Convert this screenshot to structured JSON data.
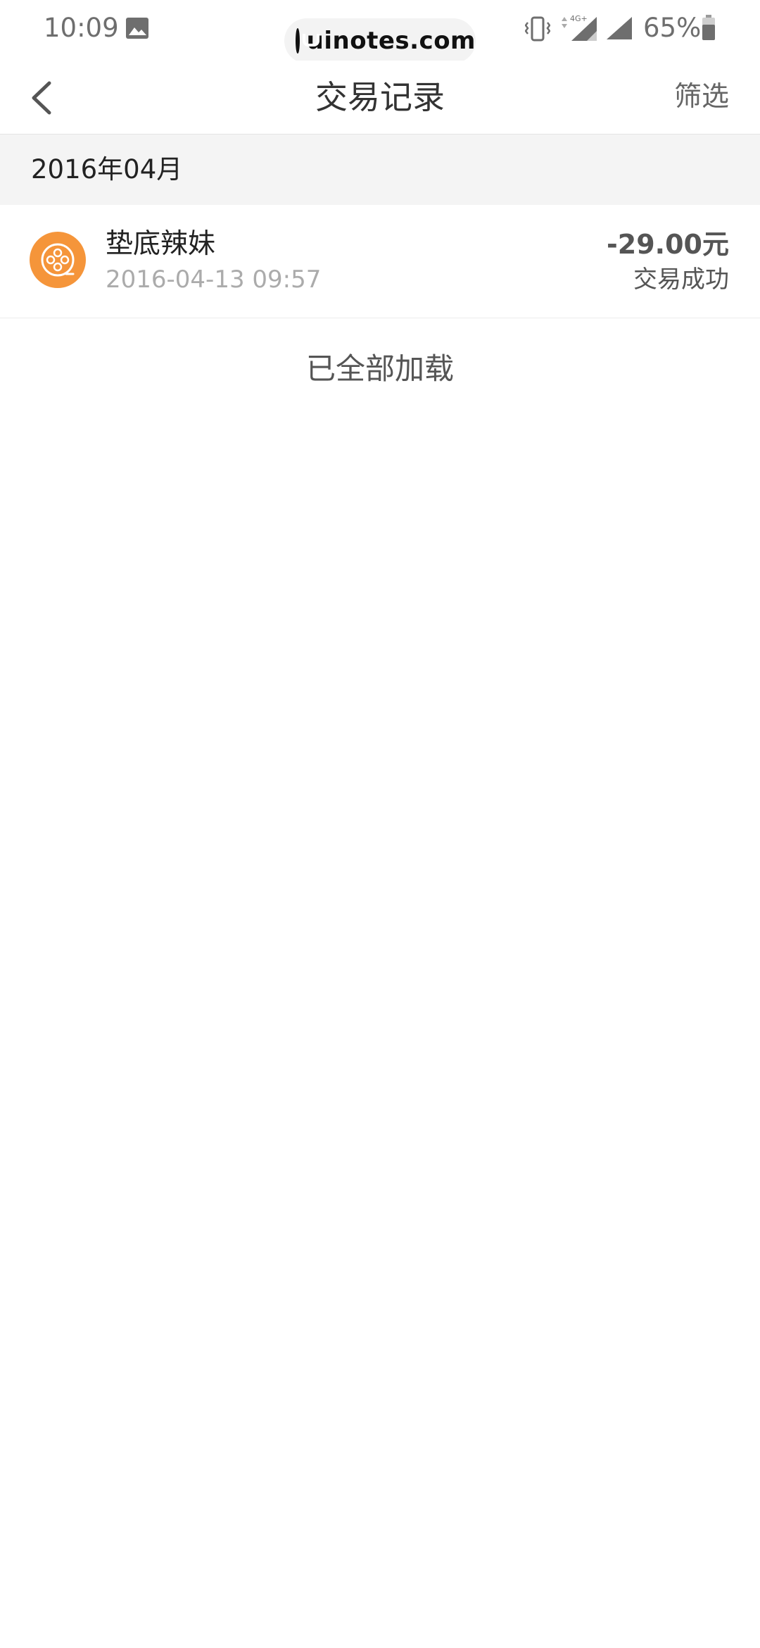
{
  "status_bar": {
    "time": "10:09",
    "watermark": "uinotes.com",
    "network": "4G+",
    "battery": "65%",
    "gallery_icon": "image-icon",
    "vibrate_icon": "vibrate-icon",
    "signal_icon": "signal-icon",
    "battery_icon": "battery-icon"
  },
  "nav": {
    "title": "交易记录",
    "filter_label": "筛选",
    "back_icon": "chevron-left-icon"
  },
  "sections": [
    {
      "month": "2016年04月",
      "transactions": [
        {
          "name": "垫底辣妹",
          "time": "2016-04-13 09:57",
          "amount": "-29.00元",
          "status": "交易成功",
          "icon": "film-reel-icon",
          "icon_color": "#f5953a"
        }
      ]
    }
  ],
  "footer": {
    "message": "已全部加载"
  },
  "colors": {
    "accent_orange": "#f5953a",
    "section_bg": "#f4f4f4",
    "secondary_text": "#ababab"
  }
}
